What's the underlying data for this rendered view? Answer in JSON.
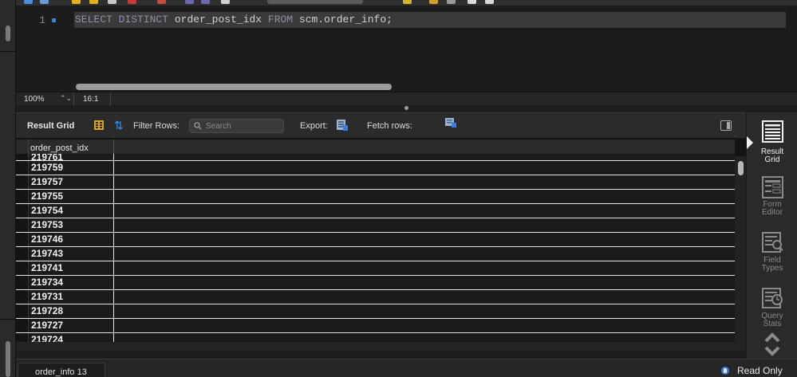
{
  "editor": {
    "line_number": "1",
    "sql_keyword_select": "SELECT",
    "sql_keyword_distinct": "DISTINCT",
    "sql_column": "order_post_idx",
    "sql_keyword_from": "FROM",
    "sql_table": "scm.order_info;"
  },
  "editor_status": {
    "zoom": "100%",
    "cursor_position": "16:1"
  },
  "result_toolbar": {
    "result_grid_label": "Result Grid",
    "filter_rows_label": "Filter Rows:",
    "search_placeholder": "Search",
    "export_label": "Export:",
    "fetch_rows_label": "Fetch rows:"
  },
  "grid": {
    "column_header": "order_post_idx",
    "rows": [
      "219761",
      "219759",
      "219757",
      "219755",
      "219754",
      "219753",
      "219746",
      "219743",
      "219741",
      "219734",
      "219731",
      "219728",
      "219727",
      "219724"
    ]
  },
  "side_panel": {
    "items": [
      {
        "line1": "Result",
        "line2": "Grid",
        "active": true
      },
      {
        "line1": "Form",
        "line2": "Editor",
        "active": false
      },
      {
        "line1": "Field",
        "line2": "Types",
        "active": false
      },
      {
        "line1": "Query",
        "line2": "Stats",
        "active": false
      }
    ]
  },
  "bottom_bar": {
    "tab_label": "order_info 13",
    "read_only_label": "Read Only"
  },
  "colors": {
    "accent_blue": "#2f8be6",
    "background": "#1e1e1e",
    "grid_cell": "#1b1b1b",
    "keyword": "#8f8fa8"
  }
}
